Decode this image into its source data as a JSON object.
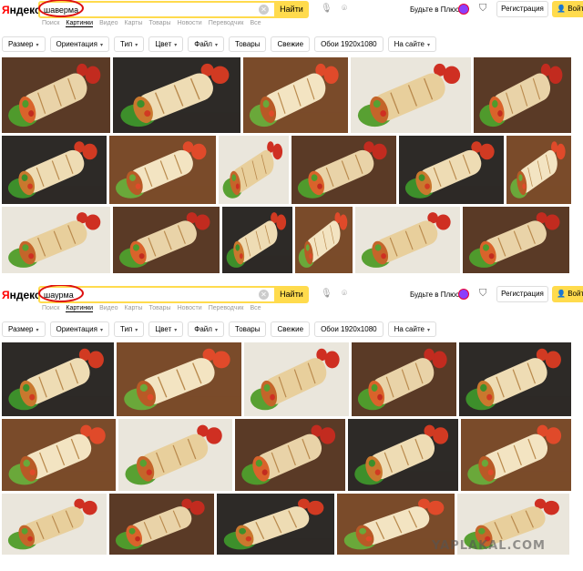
{
  "panels": [
    {
      "logo": {
        "ya": "Я",
        "rest": "ндекс"
      },
      "search": {
        "query": "шаверма",
        "find_label": "Найти"
      },
      "plus_link": "Будьте в Плюсе",
      "register_label": "Регистрация",
      "login_label": "Войти",
      "services": [
        "Поиск",
        "Картинки",
        "Видео",
        "Карты",
        "Товары",
        "Новости",
        "Переводчик",
        "Все"
      ],
      "active_service": "Картинки",
      "filters": [
        "Размер",
        "Ориентация",
        "Тип",
        "Цвет",
        "Файл",
        "Товары",
        "Свежие",
        "Обои 1920x1080",
        "На сайте"
      ],
      "filter_has_caret": [
        true,
        true,
        true,
        true,
        true,
        false,
        false,
        false,
        true
      ]
    },
    {
      "logo": {
        "ya": "Я",
        "rest": "ндекс"
      },
      "search": {
        "query": "шаурма",
        "find_label": "Найти"
      },
      "plus_link": "Будьте в Плюсе",
      "register_label": "Регистрация",
      "login_label": "Войти",
      "services": [
        "Поиск",
        "Картинки",
        "Видео",
        "Карты",
        "Товары",
        "Новости",
        "Переводчик",
        "Все"
      ],
      "active_service": "Картинки",
      "filters": [
        "Размер",
        "Ориентация",
        "Тип",
        "Цвет",
        "Файл",
        "Товары",
        "Свежие",
        "Обои 1920x1080",
        "На сайте"
      ],
      "filter_has_caret": [
        true,
        true,
        true,
        true,
        true,
        false,
        false,
        false,
        true
      ]
    }
  ],
  "watermark": "YAPLAKAL.COM",
  "colors": {
    "accent": "#ffdb4d",
    "logo_red": "#ff0000",
    "highlight_oval": "#dd1111",
    "muted_text": "#999999"
  },
  "icons": {
    "clear": "close-icon",
    "voice": "microphone-icon",
    "camera": "camera-search-icon",
    "shield": "shield-icon",
    "user": "user-icon"
  }
}
